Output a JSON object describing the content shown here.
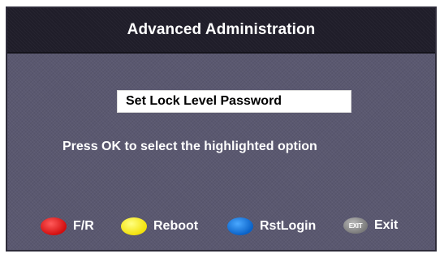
{
  "header": {
    "title": "Advanced Administration"
  },
  "menu": {
    "items": [
      {
        "label": "Set Lock Level Password",
        "highlighted": true
      }
    ]
  },
  "hint": "Press OK to select the highlighted option",
  "legend": {
    "fr": {
      "label": "F/R",
      "color": "#e01818",
      "icon": "red-button-icon"
    },
    "reboot": {
      "label": "Reboot",
      "color": "#f5e51a",
      "icon": "yellow-button-icon"
    },
    "rstlogin": {
      "label": "RstLogin",
      "color": "#1675db",
      "icon": "blue-button-icon"
    },
    "exit": {
      "badge": "EXIT",
      "label": "Exit",
      "color": "#8a8a8a",
      "icon": "exit-button-icon"
    }
  }
}
